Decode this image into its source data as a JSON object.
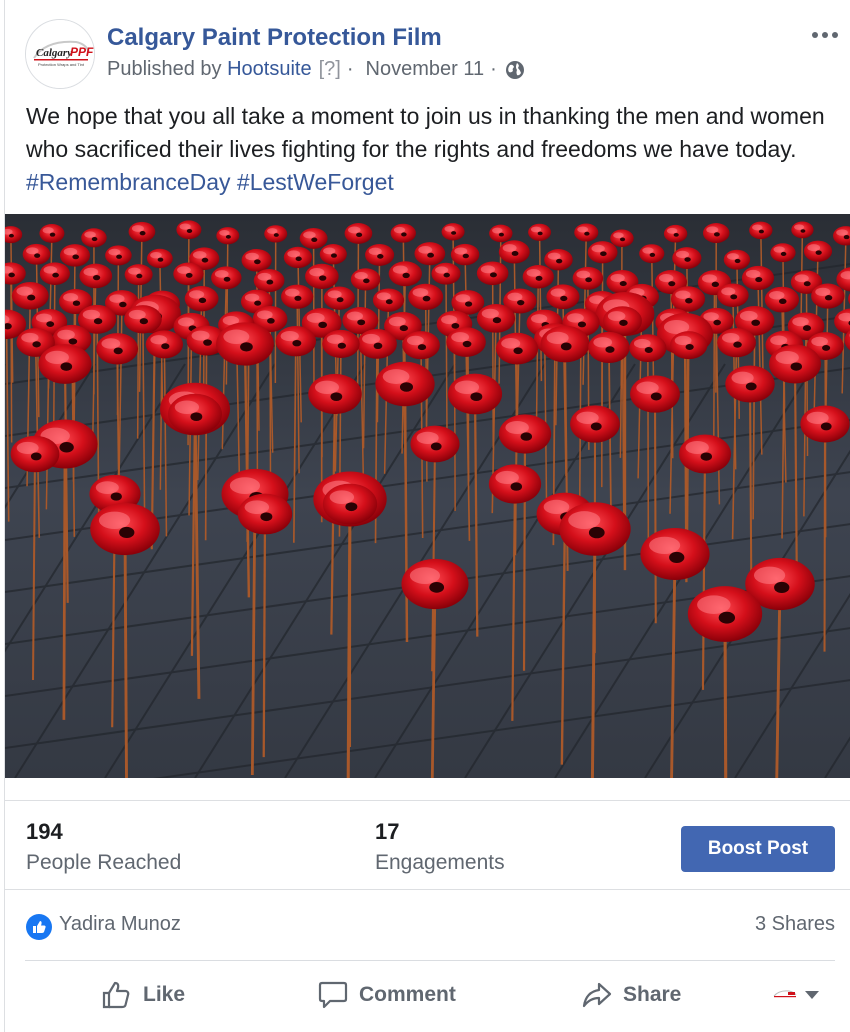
{
  "post": {
    "page_name": "Calgary Paint Protection Film",
    "published_by_prefix": "Published by",
    "publisher": "Hootsuite",
    "publisher_help": "[?]",
    "separator": "·",
    "date": "November 11",
    "privacy_icon": "globe-icon",
    "more_icon": "more-options-icon",
    "logo_text": "Calgary",
    "logo_accent_text": "PPF",
    "logo_tagline": "Protection Wraps and Tint",
    "text_body": "We hope that you all take a moment to join us in thanking the men and women who sacrificed their lives fighting for the rights and freedoms we have today. ",
    "hashtags": [
      "#RemembranceDay",
      "#LestWeForget"
    ],
    "image_subject": "ceramic red poppies on tiled pavement"
  },
  "insights": {
    "people_reached_value": "194",
    "people_reached_label": "People Reached",
    "engagements_value": "17",
    "engagements_label": "Engagements",
    "boost_label": "Boost Post"
  },
  "reactions": {
    "reactor_name": "Yadira Munoz",
    "shares_label": "3 Shares",
    "reaction_icon": "like-reaction-icon"
  },
  "actions": {
    "like_label": "Like",
    "comment_label": "Comment",
    "share_label": "Share",
    "audience_icon": "chevron-down-icon"
  },
  "colors": {
    "link_blue": "#365899",
    "boost_blue": "#4267b2",
    "poppy_red": "#d0111a",
    "pavement": "#3d434c"
  }
}
